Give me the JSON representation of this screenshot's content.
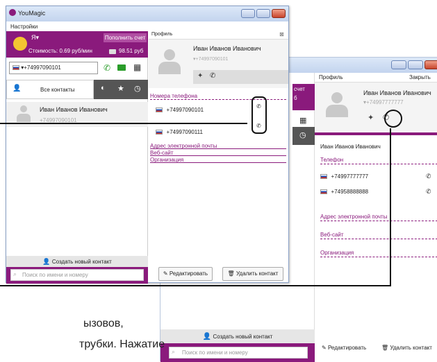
{
  "front": {
    "title": "YouMagic",
    "menu": "Настройки",
    "user_name": "Я",
    "topup_label": "Пополнить счет",
    "rate": "Стоимость: 0.69 руб/мин",
    "balance": "98.51 руб",
    "phone_input": "+74997090101",
    "tab_all": "Все контакты",
    "contact_name": "Иван Иванов Иванович",
    "contact_phone": "+74997090101",
    "create_contact": "Создать новый контакт",
    "search_placeholder": "Поиск по имени и номеру",
    "profile_title": "Профиль",
    "profile_name": "Иван Иванов Иванович",
    "profile_phone": "+74997090101",
    "section_phone": "Номера телефона",
    "phone1": "+74997090101",
    "phone2": "+74997090111",
    "section_email": "Адрес электронной почты",
    "section_web": "Веб-сайт",
    "section_org": "Организация",
    "edit_button": "Редактировать",
    "delete_button": "Удалить контакт"
  },
  "back": {
    "profile_title": "Профиль",
    "close_label": "Закрыть",
    "profile_name": "Иван Иванов Иванович",
    "profile_phone": "+74997777777",
    "topup_fragment": "счет",
    "balance_fragment": "б",
    "contact_name": "Иван Иванов Иванович",
    "section_phone": "Телефон",
    "phone1": "+74997777777",
    "phone2": "+74958888888",
    "section_email": "Адрес электронной почты",
    "section_web": "Веб-сайт",
    "section_org": "Организация",
    "create_contact": "Создать новый контакт",
    "search_placeholder": "Поиск по имени и номеру",
    "edit_button": "Редактировать",
    "delete_button": "Удалить контакт"
  },
  "caption": {
    "line1": "ызовов,",
    "line2": "трубки. Нажатие"
  },
  "colors": {
    "accent": "#8a1a7c",
    "call_green": "#2a9d2a"
  }
}
